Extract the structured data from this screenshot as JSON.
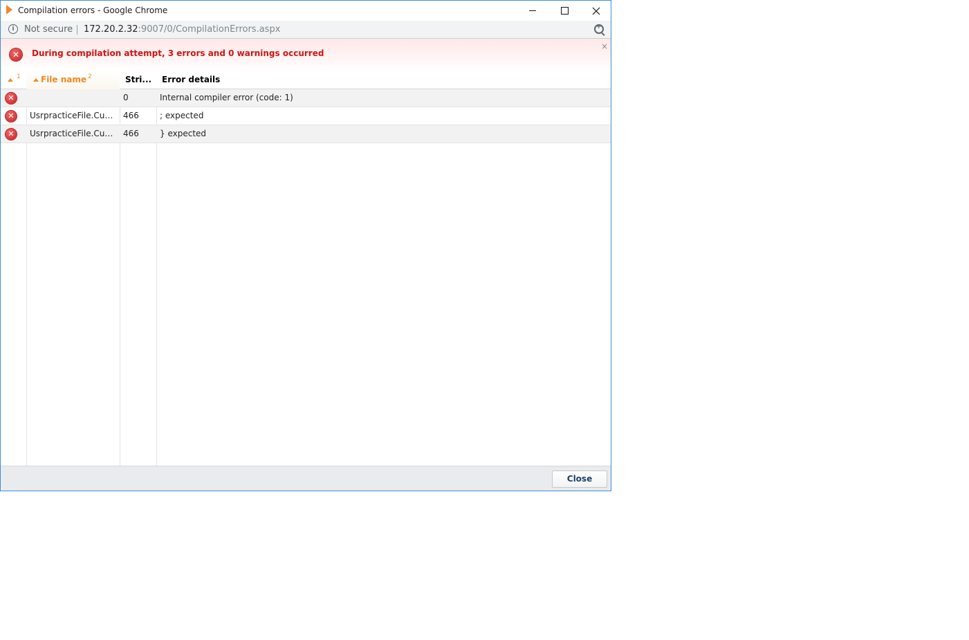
{
  "window": {
    "title": "Compilation errors - Google Chrome",
    "colors": {
      "border": "#3c8fd8",
      "accent": "#f08a24",
      "error": "#d01515"
    }
  },
  "address_bar": {
    "security_label": "Not secure",
    "url_host": "172.20.2.32",
    "url_rest": ":9007/0/CompilationErrors.aspx"
  },
  "banner": {
    "message": "During compilation attempt, 3 errors and 0 warnings occurred",
    "close_glyph": "×"
  },
  "grid": {
    "columns": [
      {
        "label": "",
        "sort_index": "1"
      },
      {
        "label": "File name",
        "sort_index": "2"
      },
      {
        "label": "Stri...",
        "sort_index": ""
      },
      {
        "label": "Error details",
        "sort_index": ""
      }
    ],
    "rows": [
      {
        "icon": "error-icon",
        "file": "",
        "line": "0",
        "details": "Internal compiler error (code: 1)"
      },
      {
        "icon": "error-icon",
        "file": "UsrpracticeFile.Custo...",
        "line": "466",
        "details": "; expected"
      },
      {
        "icon": "error-icon",
        "file": "UsrpracticeFile.Custo...",
        "line": "466",
        "details": "} expected"
      }
    ]
  },
  "footer": {
    "close_label": "Close"
  }
}
